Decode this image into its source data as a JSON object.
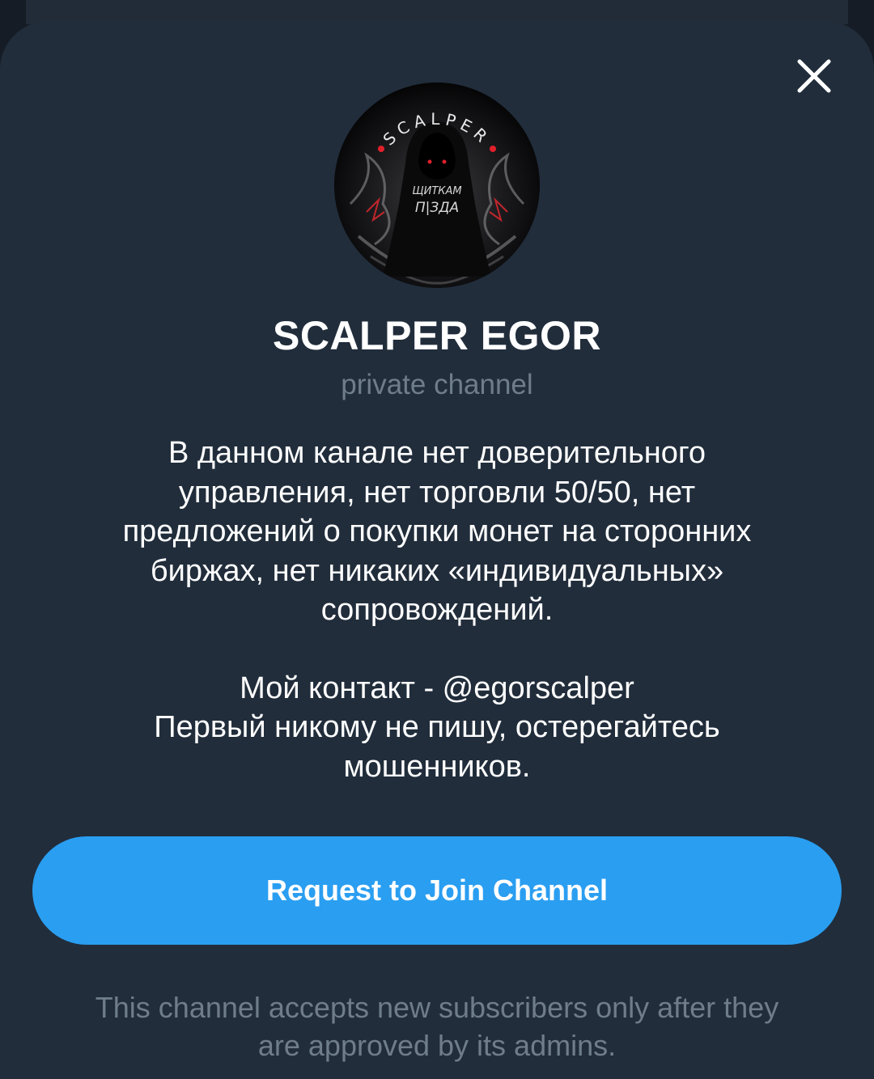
{
  "channel": {
    "name": "SCALPER EGOR",
    "type_label": "private channel",
    "avatar": {
      "ring_text": "SCALPER",
      "center_text_line1": "ЩИТКАМ",
      "center_text_line2": "П|ЗДА"
    },
    "description_lines": [
      "В данном канале нет доверительного",
      "управления, нет торговли 50/50, нет",
      "предложений о покупки монет на сторонних",
      "биржах, нет никаких «индивидуальных»",
      "сопровождений."
    ],
    "contact_lines": [
      "Мой контакт - @egorscalper",
      "Первый никому не пишу, остерегайтесь",
      "мошенников."
    ]
  },
  "actions": {
    "join_label": "Request to Join Channel",
    "close_icon": "close-icon"
  },
  "footnote": {
    "line1": "This channel accepts new subscribers only after they",
    "line2": "are approved by its admins."
  },
  "colors": {
    "sheet_bg": "#212d3b",
    "accent": "#2a9ef1",
    "muted_text": "#6f7d8b"
  }
}
